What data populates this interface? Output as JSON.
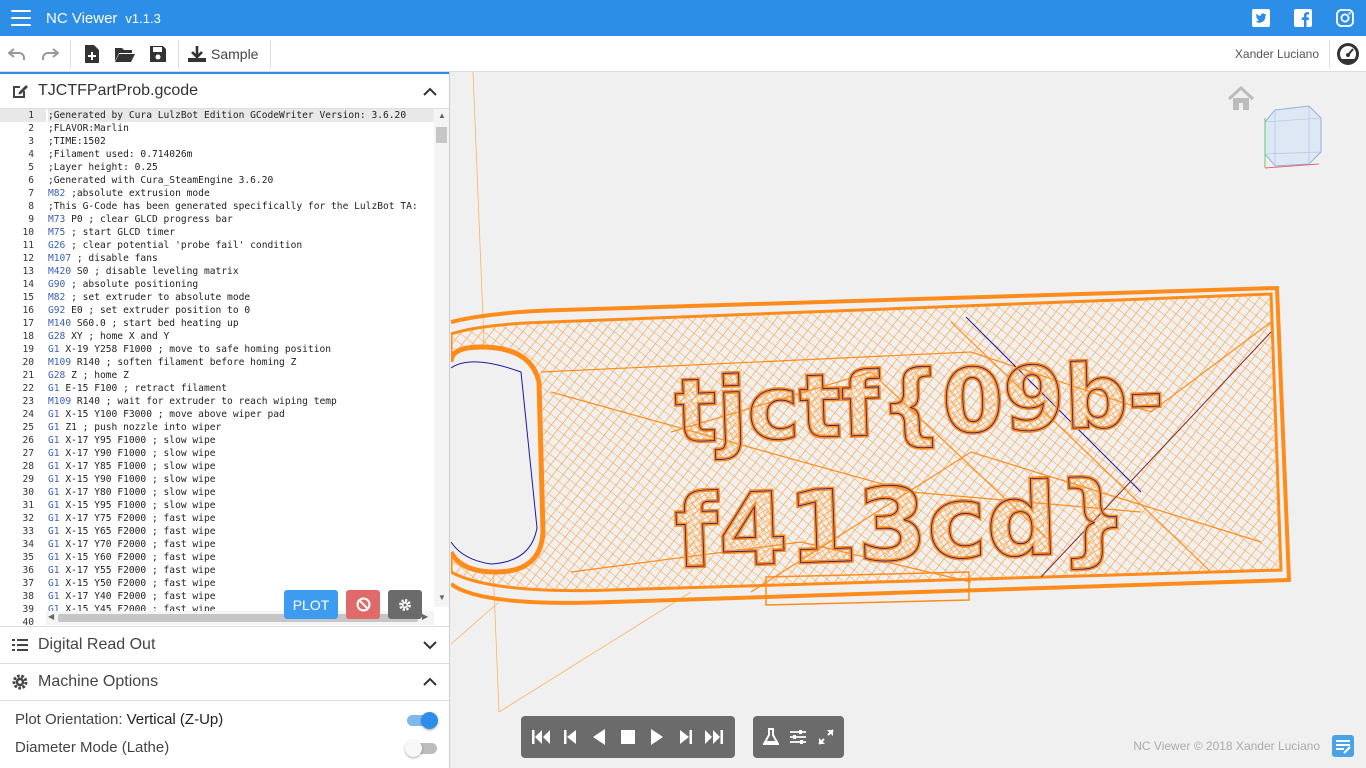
{
  "app": {
    "title": "NC Viewer",
    "version": "v1.1.3"
  },
  "social": [
    "twitter-icon",
    "facebook-icon",
    "instagram-icon"
  ],
  "toolbar": {
    "sample_label": "Sample",
    "user": "Xander Luciano"
  },
  "file": {
    "name": "TJCTFPartProb.gcode"
  },
  "editor": {
    "active_line": 1,
    "lines": [
      ";Generated by Cura LulzBot Edition GCodeWriter Version: 3.6.20",
      ";FLAVOR:Marlin",
      ";TIME:1502",
      ";Filament used: 0.714026m",
      ";Layer height: 0.25",
      ";Generated with Cura_SteamEngine 3.6.20",
      "M82 ;absolute extrusion mode",
      ";This G-Code has been generated specifically for the LulzBot TA:",
      "M73 P0 ; clear GLCD progress bar",
      "M75 ; start GLCD timer",
      "G26 ; clear potential 'probe fail' condition",
      "M107 ; disable fans",
      "M420 S0 ; disable leveling matrix",
      "G90 ; absolute positioning",
      "M82 ; set extruder to absolute mode",
      "G92 E0 ; set extruder position to 0",
      "M140 S60.0 ; start bed heating up",
      "G28 XY ; home X and Y",
      "G1 X-19 Y258 F1000 ; move to safe homing position",
      "M109 R140 ; soften filament before homing Z",
      "G28 Z ; home Z",
      "G1 E-15 F100 ; retract filament",
      "M109 R140 ; wait for extruder to reach wiping temp",
      "G1 X-15 Y100 F3000 ; move above wiper pad",
      "G1 Z1 ; push nozzle into wiper",
      "G1 X-17 Y95 F1000 ; slow wipe",
      "G1 X-17 Y90 F1000 ; slow wipe",
      "G1 X-17 Y85 F1000 ; slow wipe",
      "G1 X-15 Y90 F1000 ; slow wipe",
      "G1 X-17 Y80 F1000 ; slow wipe",
      "G1 X-15 Y95 F1000 ; slow wipe",
      "G1 X-17 Y75 F2000 ; fast wipe",
      "G1 X-15 Y65 F2000 ; fast wipe",
      "G1 X-17 Y70 F2000 ; fast wipe",
      "G1 X-15 Y60 F2000 ; fast wipe",
      "G1 X-17 Y55 F2000 ; fast wipe",
      "G1 X-15 Y50 F2000 ; fast wipe",
      "G1 X-17 Y40 F2000 ; fast wipe",
      "G1 X-15 Y45 F2000 ; fast wipe",
      ""
    ],
    "plot_label": "PLOT"
  },
  "panels": {
    "dro_title": "Digital Read Out",
    "machine_title": "Machine Options"
  },
  "options": {
    "orientation_label": "Plot Orientation:",
    "orientation_value": "Vertical (Z-Up)",
    "orientation_on": true,
    "diameter_label": "Diameter Mode (Lathe)",
    "diameter_on": false
  },
  "colors": {
    "accent": "#2d8ee8",
    "toolpath": "#ff8c1a",
    "travel": "#1a1aa0"
  },
  "footer": {
    "copyright": "NC Viewer © 2018 Xander Luciano"
  }
}
